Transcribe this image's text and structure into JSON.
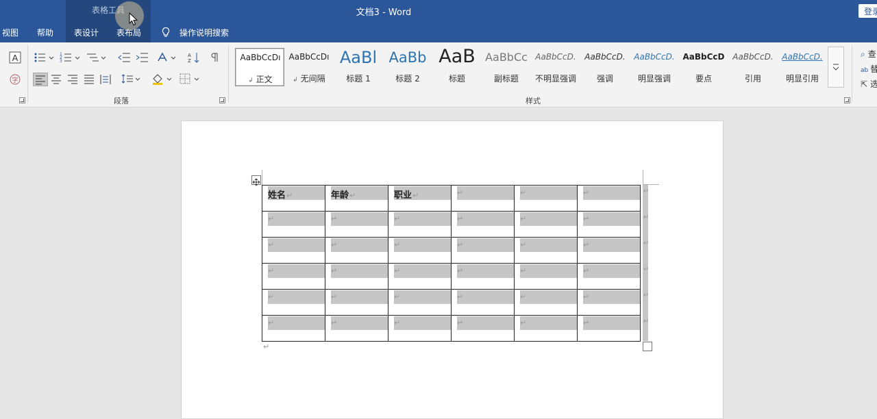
{
  "titlebar": {
    "context_tools": "表格工具",
    "doc_title": "文档3  -  Word",
    "login": "登录"
  },
  "tabs": {
    "view": "视图",
    "help": "帮助",
    "table_design": "表设计",
    "table_layout": "表布局",
    "search": "操作说明搜索"
  },
  "ribbon": {
    "paragraph_label": "段落",
    "styles_label": "样式",
    "styles": [
      {
        "preview": "AaBbCcDı",
        "name": "正文",
        "marker": "↲"
      },
      {
        "preview": "AaBbCcDı",
        "name": "无间隔",
        "marker": "↲"
      },
      {
        "preview": "AaBl",
        "name": "标题 1"
      },
      {
        "preview": "AaBb",
        "name": "标题 2"
      },
      {
        "preview": "AaB",
        "name": "标题"
      },
      {
        "preview": "AaBbCc",
        "name": "副标题"
      },
      {
        "preview": "AaBbCcD.",
        "name": "不明显强调"
      },
      {
        "preview": "AaBbCcD.",
        "name": "强调"
      },
      {
        "preview": "AaBbCcD.",
        "name": "明显强调"
      },
      {
        "preview": "AaBbCcD",
        "name": "要点"
      },
      {
        "preview": "AaBbCcD.",
        "name": "引用"
      },
      {
        "preview": "AaBbCcD.",
        "name": "明显引用"
      }
    ],
    "editing": {
      "find": "查",
      "replace": "替",
      "select": "选"
    }
  },
  "document": {
    "table_headers": [
      "姓名",
      "年龄",
      "职业",
      "",
      "",
      ""
    ],
    "empty_rows": 5,
    "paragraph_mark": "↵"
  },
  "colors": {
    "brand": "#2b579a",
    "context_tab": "#24487d",
    "cell_shading": "#c6c6c6"
  }
}
